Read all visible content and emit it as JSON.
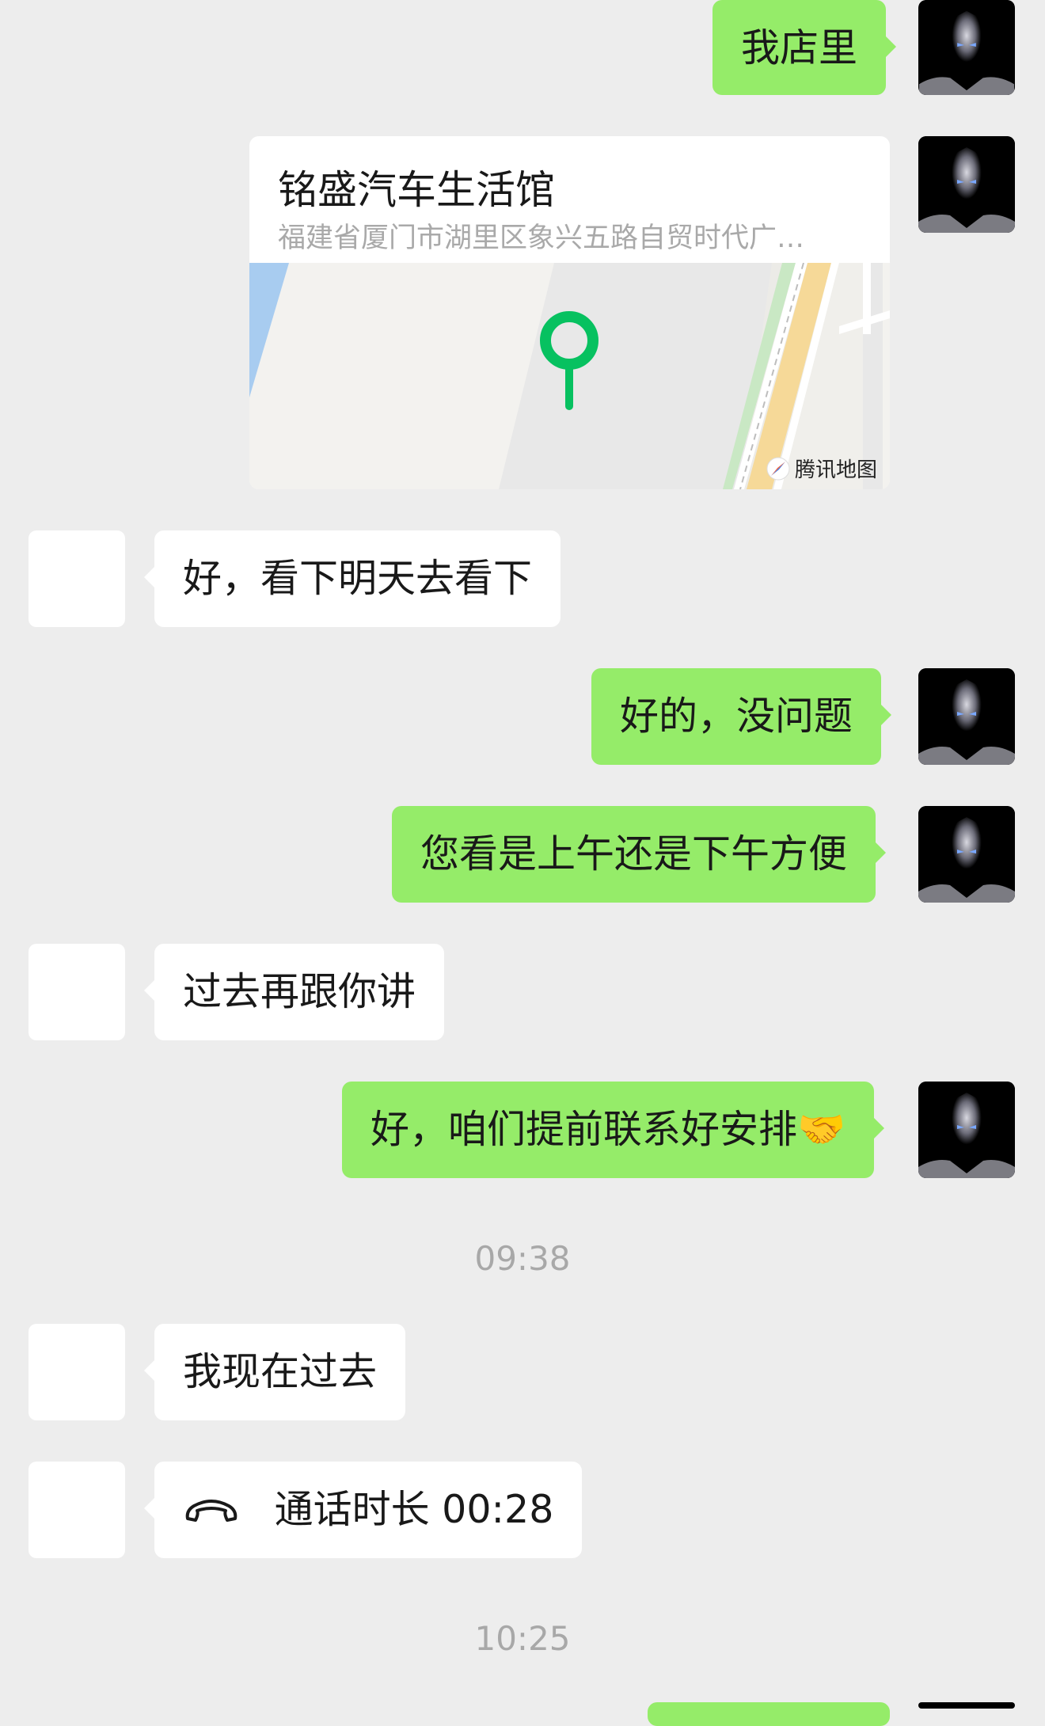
{
  "messages": {
    "m1": "我店里",
    "loc_title": "铭盛汽车生活馆",
    "loc_addr": "福建省厦门市湖里区象兴五路自贸时代广…",
    "map_brand": "腾讯地图",
    "m2": "好，看下明天去看下",
    "m3": "好的，没问题",
    "m4": "您看是上午还是下午方便",
    "m5": "过去再跟你讲",
    "m6": "好，咱们提前联系好安排🤝",
    "ts1": "09:38",
    "m7": "我现在过去",
    "call": "通话时长 00:28",
    "ts2": "10:25"
  },
  "colors": {
    "background": "#ededed",
    "my_bubble": "#95ec69",
    "their_bubble": "#ffffff",
    "map_pin": "#07c160"
  }
}
